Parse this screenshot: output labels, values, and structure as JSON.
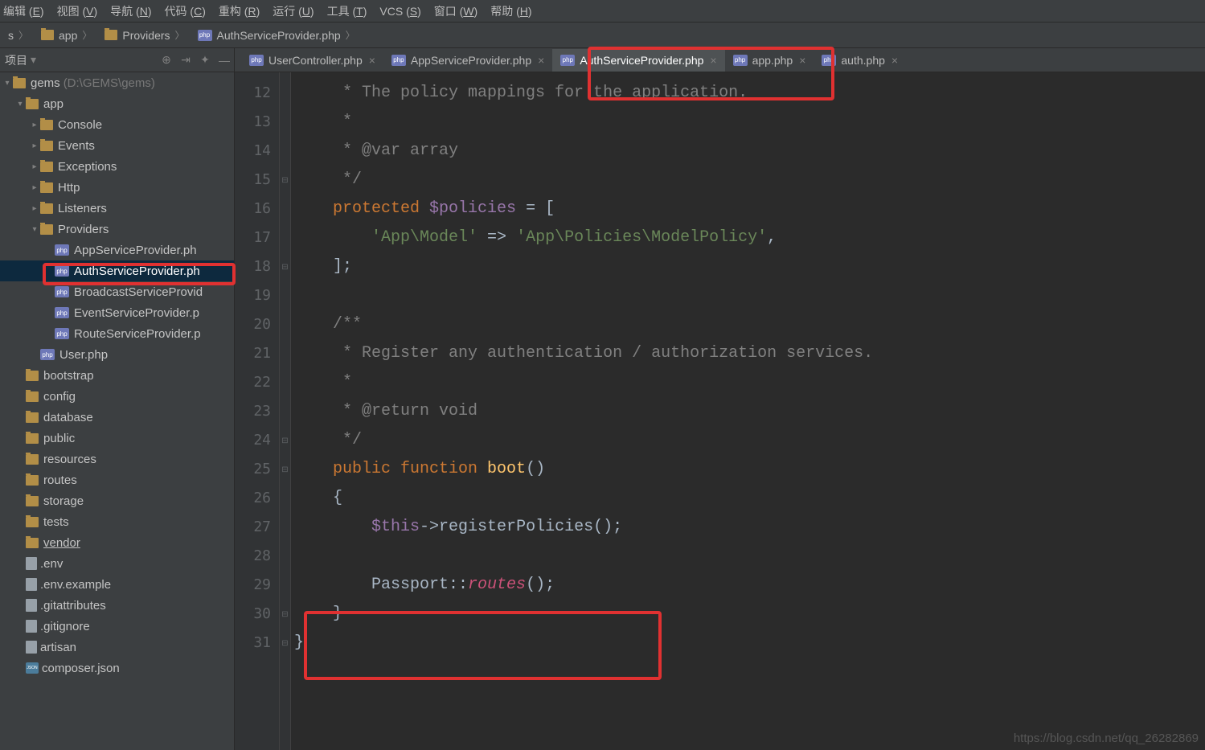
{
  "menu": [
    "编辑 (E)",
    "视图 (V)",
    "导航 (N)",
    "代码 (C)",
    "重构 (R)",
    "运行 (U)",
    "工具 (T)",
    "VCS (S)",
    "窗口 (W)",
    "帮助 (H)"
  ],
  "breadcrumb": [
    {
      "kind": "stub",
      "label": "s"
    },
    {
      "kind": "dir",
      "label": "app"
    },
    {
      "kind": "dir",
      "label": "Providers"
    },
    {
      "kind": "php",
      "label": "AuthServiceProvider.php"
    }
  ],
  "sidebar": {
    "title": "项目",
    "root": {
      "label": "gems",
      "hint": "(D:\\GEMS\\gems)"
    },
    "tree": [
      {
        "depth": 1,
        "arrow": "down",
        "icon": "dir",
        "label": "app"
      },
      {
        "depth": 2,
        "arrow": "right",
        "icon": "dir",
        "label": "Console"
      },
      {
        "depth": 2,
        "arrow": "right",
        "icon": "dir",
        "label": "Events"
      },
      {
        "depth": 2,
        "arrow": "right",
        "icon": "dir",
        "label": "Exceptions"
      },
      {
        "depth": 2,
        "arrow": "right",
        "icon": "dir",
        "label": "Http"
      },
      {
        "depth": 2,
        "arrow": "right",
        "icon": "dir",
        "label": "Listeners"
      },
      {
        "depth": 2,
        "arrow": "down",
        "icon": "dir",
        "label": "Providers"
      },
      {
        "depth": 3,
        "arrow": "",
        "icon": "php",
        "label": "AppServiceProvider.ph"
      },
      {
        "depth": 3,
        "arrow": "",
        "icon": "php",
        "label": "AuthServiceProvider.ph",
        "selected": true
      },
      {
        "depth": 3,
        "arrow": "",
        "icon": "php",
        "label": "BroadcastServiceProvid"
      },
      {
        "depth": 3,
        "arrow": "",
        "icon": "php",
        "label": "EventServiceProvider.p"
      },
      {
        "depth": 3,
        "arrow": "",
        "icon": "php",
        "label": "RouteServiceProvider.p"
      },
      {
        "depth": 2,
        "arrow": "",
        "icon": "php",
        "label": "User.php"
      },
      {
        "depth": 1,
        "arrow": "",
        "icon": "dir",
        "label": "bootstrap"
      },
      {
        "depth": 1,
        "arrow": "",
        "icon": "dir",
        "label": "config"
      },
      {
        "depth": 1,
        "arrow": "",
        "icon": "dir",
        "label": "database"
      },
      {
        "depth": 1,
        "arrow": "",
        "icon": "dir",
        "label": "public"
      },
      {
        "depth": 1,
        "arrow": "",
        "icon": "dir",
        "label": "resources"
      },
      {
        "depth": 1,
        "arrow": "",
        "icon": "dir",
        "label": "routes"
      },
      {
        "depth": 1,
        "arrow": "",
        "icon": "dir",
        "label": "storage"
      },
      {
        "depth": 1,
        "arrow": "",
        "icon": "dir",
        "label": "tests"
      },
      {
        "depth": 1,
        "arrow": "",
        "icon": "dir",
        "label": "vendor",
        "underline": true
      },
      {
        "depth": 1,
        "arrow": "",
        "icon": "file",
        "label": ".env"
      },
      {
        "depth": 1,
        "arrow": "",
        "icon": "file",
        "label": ".env.example"
      },
      {
        "depth": 1,
        "arrow": "",
        "icon": "file",
        "label": ".gitattributes"
      },
      {
        "depth": 1,
        "arrow": "",
        "icon": "file",
        "label": ".gitignore"
      },
      {
        "depth": 1,
        "arrow": "",
        "icon": "file",
        "label": "artisan"
      },
      {
        "depth": 1,
        "arrow": "",
        "icon": "json",
        "label": "composer.json"
      }
    ]
  },
  "tabs": [
    {
      "label": "UserController.php",
      "icon": "php"
    },
    {
      "label": "AppServiceProvider.php",
      "icon": "php"
    },
    {
      "label": "AuthServiceProvider.php",
      "icon": "php",
      "active": true
    },
    {
      "label": "app.php",
      "icon": "php"
    },
    {
      "label": "auth.php",
      "icon": "php"
    }
  ],
  "code": {
    "start": 12,
    "lines": [
      [
        {
          "cls": "c-comment",
          "t": "     * The policy mappings for the application."
        }
      ],
      [
        {
          "cls": "c-comment",
          "t": "     *"
        }
      ],
      [
        {
          "cls": "c-comment",
          "t": "     * @var array"
        }
      ],
      [
        {
          "cls": "c-comment",
          "t": "     */"
        }
      ],
      [
        {
          "cls": "c-keyword",
          "t": "    protected "
        },
        {
          "cls": "c-var",
          "t": "$policies"
        },
        {
          "cls": "c-op",
          "t": " = ["
        }
      ],
      [
        {
          "cls": "c-string",
          "t": "        'App\\Model'"
        },
        {
          "cls": "c-op",
          "t": " => "
        },
        {
          "cls": "c-string",
          "t": "'App\\Policies\\ModelPolicy'"
        },
        {
          "cls": "c-op",
          "t": ","
        }
      ],
      [
        {
          "cls": "c-op",
          "t": "    ];"
        }
      ],
      [
        {
          "cls": "",
          "t": ""
        }
      ],
      [
        {
          "cls": "c-comment",
          "t": "    /**"
        }
      ],
      [
        {
          "cls": "c-comment",
          "t": "     * Register any authentication / authorization services."
        }
      ],
      [
        {
          "cls": "c-comment",
          "t": "     *"
        }
      ],
      [
        {
          "cls": "c-comment",
          "t": "     * @return void"
        }
      ],
      [
        {
          "cls": "c-comment",
          "t": "     */"
        }
      ],
      [
        {
          "cls": "c-keyword",
          "t": "    public function "
        },
        {
          "cls": "c-method",
          "t": "boot"
        },
        {
          "cls": "c-op",
          "t": "()"
        }
      ],
      [
        {
          "cls": "c-op",
          "t": "    {"
        }
      ],
      [
        {
          "cls": "c-var",
          "t": "        $this"
        },
        {
          "cls": "c-op",
          "t": "->"
        },
        {
          "cls": "c-plain",
          "t": "registerPolicies"
        },
        {
          "cls": "c-op",
          "t": "();"
        }
      ],
      [
        {
          "cls": "",
          "t": ""
        }
      ],
      [
        {
          "cls": "c-plain",
          "t": "        Passport"
        },
        {
          "cls": "c-op",
          "t": "::"
        },
        {
          "cls": "c-static",
          "t": "routes"
        },
        {
          "cls": "c-op",
          "t": "();"
        }
      ],
      [
        {
          "cls": "c-op",
          "t": "    }"
        }
      ],
      [
        {
          "cls": "c-op",
          "t": "}"
        }
      ]
    ],
    "fold": [
      "",
      "",
      "",
      "⊟",
      "",
      "",
      "⊟",
      "",
      "",
      "",
      "",
      "",
      "⊟",
      "⊟",
      "",
      "",
      "",
      "",
      "⊟",
      "⊟"
    ]
  },
  "watermark": "https://blog.csdn.net/qq_26282869"
}
